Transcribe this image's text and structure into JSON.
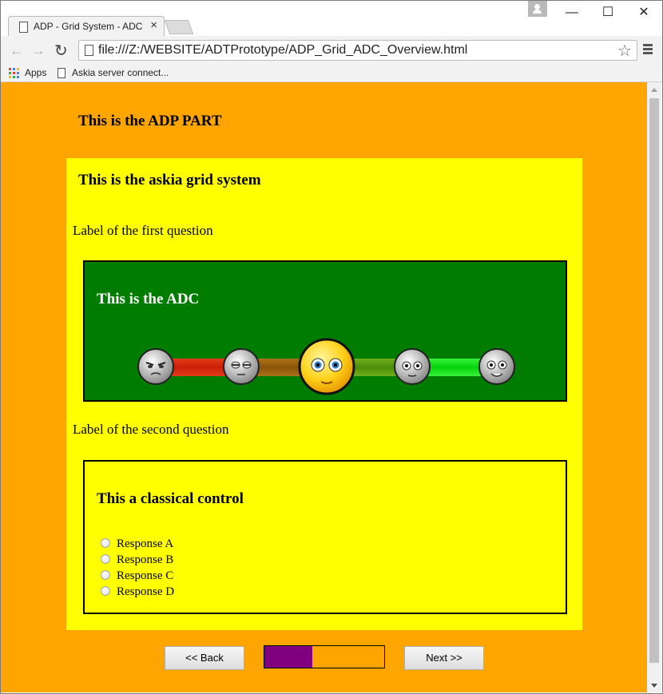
{
  "browser": {
    "tab_title": "ADP - Grid System - ADC",
    "address": "file:///Z:/WEBSITE/ADTPrototype/ADP_Grid_ADC_Overview.html",
    "bookmarks": [
      "Apps",
      "Askia server connect..."
    ]
  },
  "page": {
    "adp_title": "This is the ADP PART",
    "grid_title": "This is the askia grid system",
    "question1_label": "Label of the first question",
    "adc": {
      "title": "This is the ADC",
      "scale": [
        {
          "icon": "angry-face-icon",
          "selected": false
        },
        {
          "icon": "sleepy-face-icon",
          "selected": false
        },
        {
          "icon": "surprised-face-icon",
          "selected": true
        },
        {
          "icon": "neutral-face-icon",
          "selected": false
        },
        {
          "icon": "smiling-face-icon",
          "selected": false
        }
      ],
      "track_colors": [
        "#e0270f",
        "#9d640f",
        "#5d9a10",
        "#0ce40b"
      ]
    },
    "question2_label": "Label of the second question",
    "classic": {
      "title": "This a classical control",
      "responses": [
        "Response A",
        "Response B",
        "Response C",
        "Response D"
      ]
    },
    "nav": {
      "back_label": "<< Back",
      "next_label": "Next >>",
      "progress": 0.4
    },
    "colors": {
      "page_bg": "#ffa500",
      "grid_bg": "#ffff00",
      "adc_bg": "#007d00",
      "progress_fill": "#800080"
    }
  }
}
